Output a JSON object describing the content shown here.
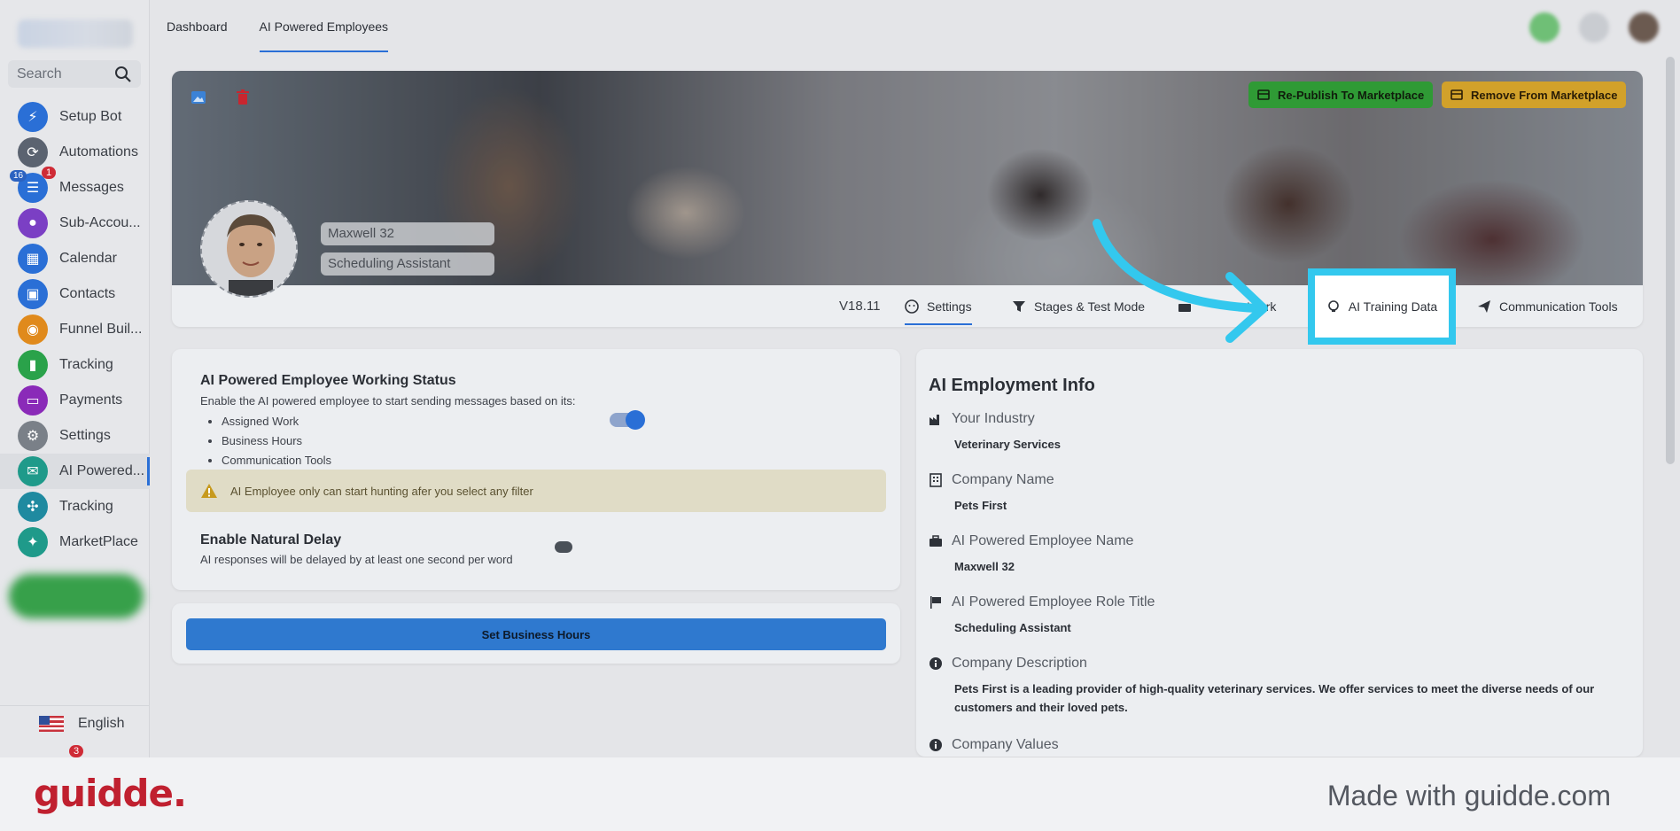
{
  "sidebar": {
    "search_placeholder": "Search",
    "items": [
      {
        "label": "Setup Bot",
        "icon": "bolt-icon",
        "color": "#2a6fd6"
      },
      {
        "label": "Automations",
        "icon": "sync-icon",
        "color": "#5b6370"
      },
      {
        "label": "Messages",
        "icon": "chat-icon",
        "color": "#2a6fd6",
        "badge": "1",
        "count": "16"
      },
      {
        "label": "Sub-Accou...",
        "icon": "user-icon",
        "color": "#7b3fc4"
      },
      {
        "label": "Calendar",
        "icon": "calendar-icon",
        "color": "#2a6fd6"
      },
      {
        "label": "Contacts",
        "icon": "contact-card-icon",
        "color": "#2a6fd6"
      },
      {
        "label": "Funnel Buil...",
        "icon": "funnel-icon",
        "color": "#e08a1c"
      },
      {
        "label": "Tracking",
        "icon": "bar-chart-icon",
        "color": "#2aa24a"
      },
      {
        "label": "Payments",
        "icon": "credit-card-icon",
        "color": "#8a2ab8"
      },
      {
        "label": "Settings",
        "icon": "gear-icon",
        "color": "#7a8088"
      },
      {
        "label": "AI Powered...",
        "icon": "ai-chat-icon",
        "color": "#1f9a8a",
        "active": true
      },
      {
        "label": "Tracking",
        "icon": "network-icon",
        "color": "#1f8aa0"
      },
      {
        "label": "MarketPlace",
        "icon": "bulb-icon",
        "color": "#1f9a8a"
      }
    ],
    "language": "English",
    "bottom_badge": "3"
  },
  "topbar": {
    "tabs": [
      {
        "label": "Dashboard"
      },
      {
        "label": "AI Powered Employees",
        "active": true
      }
    ]
  },
  "banner": {
    "republish_label": "Re-Publish To Marketplace",
    "remove_label": "Remove From Marketplace",
    "employee_name": "Maxwell 32",
    "employee_role": "Scheduling Assistant",
    "version": "V18.11",
    "subtabs": [
      {
        "label": "Settings",
        "active": true
      },
      {
        "label": "Stages & Test Mode"
      },
      {
        "label": "Work"
      },
      {
        "label": "AI Training Data",
        "highlighted": true
      },
      {
        "label": "Communication Tools"
      }
    ]
  },
  "status": {
    "title": "AI Powered Employee Working Status",
    "description": "Enable the AI powered employee to start sending messages based on its:",
    "bullets": [
      "Assigned Work",
      "Business Hours",
      "Communication Tools"
    ],
    "working_enabled": true,
    "warning": "AI Employee only can start hunting afer you select any filter",
    "delay_title": "Enable Natural Delay",
    "delay_description": "AI responses will be delayed by at least one second per word",
    "delay_enabled": false
  },
  "hours_button": "Set Business Hours",
  "info": {
    "title": "AI Employment Info",
    "rows": [
      {
        "label": "Your Industry",
        "value": "Veterinary Services",
        "icon": "factory-icon"
      },
      {
        "label": "Company Name",
        "value": "Pets First",
        "icon": "building-icon"
      },
      {
        "label": "AI Powered Employee Name",
        "value": "Maxwell 32",
        "icon": "briefcase-icon"
      },
      {
        "label": "AI Powered Employee Role Title",
        "value": "Scheduling Assistant",
        "icon": "flag-icon"
      },
      {
        "label": "Company Description",
        "value": "Pets First is a leading provider of high-quality veterinary services. We offer services to meet the diverse needs of our customers and their loved pets.",
        "icon": "info-icon"
      },
      {
        "label": "Company Values",
        "value": "",
        "icon": "info-icon"
      }
    ]
  },
  "footer": {
    "logo": "guidde.",
    "made_with": "Made with guidde.com"
  }
}
